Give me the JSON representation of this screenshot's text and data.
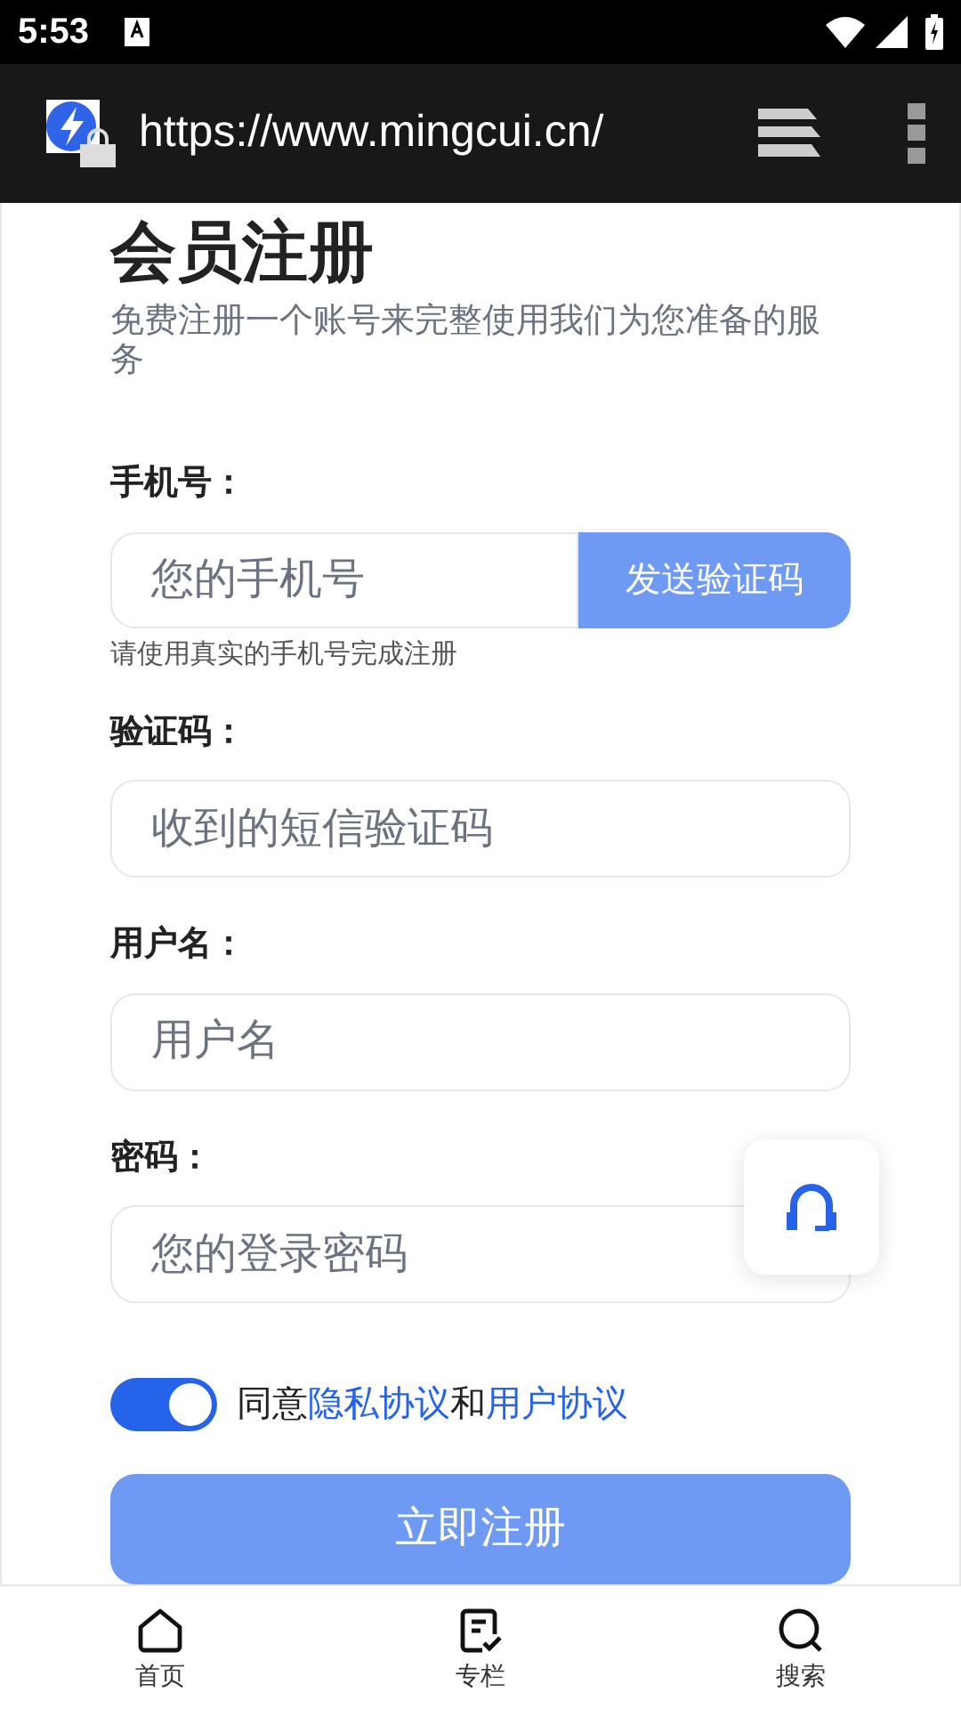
{
  "status_bar": {
    "time": "5:53"
  },
  "browser": {
    "url": "https://www.mingcui.cn/"
  },
  "page": {
    "title": "会员注册",
    "subtitle": "免费注册一个账号来完整使用我们为您准备的服务"
  },
  "fields": [
    {
      "kind": "phone",
      "label": "手机号：",
      "placeholder": "您的手机号",
      "button": "发送验证码",
      "hint": "请使用真实的手机号完成注册"
    },
    {
      "kind": "text",
      "label": "验证码：",
      "placeholder": "收到的短信验证码"
    },
    {
      "kind": "text",
      "label": "用户名：",
      "placeholder": "用户名"
    },
    {
      "kind": "password",
      "label": "密码：",
      "placeholder": "您的登录密码"
    }
  ],
  "agreement": {
    "on": true,
    "text_1": "同意",
    "link_1": "隐私协议",
    "text_2": "和",
    "link_2": "用户协议"
  },
  "submit": "立即注册",
  "bottom_nav": [
    {
      "label": "首页",
      "kind": "home"
    },
    {
      "label": "专栏",
      "kind": "column"
    },
    {
      "label": "搜索",
      "kind": "search"
    }
  ]
}
